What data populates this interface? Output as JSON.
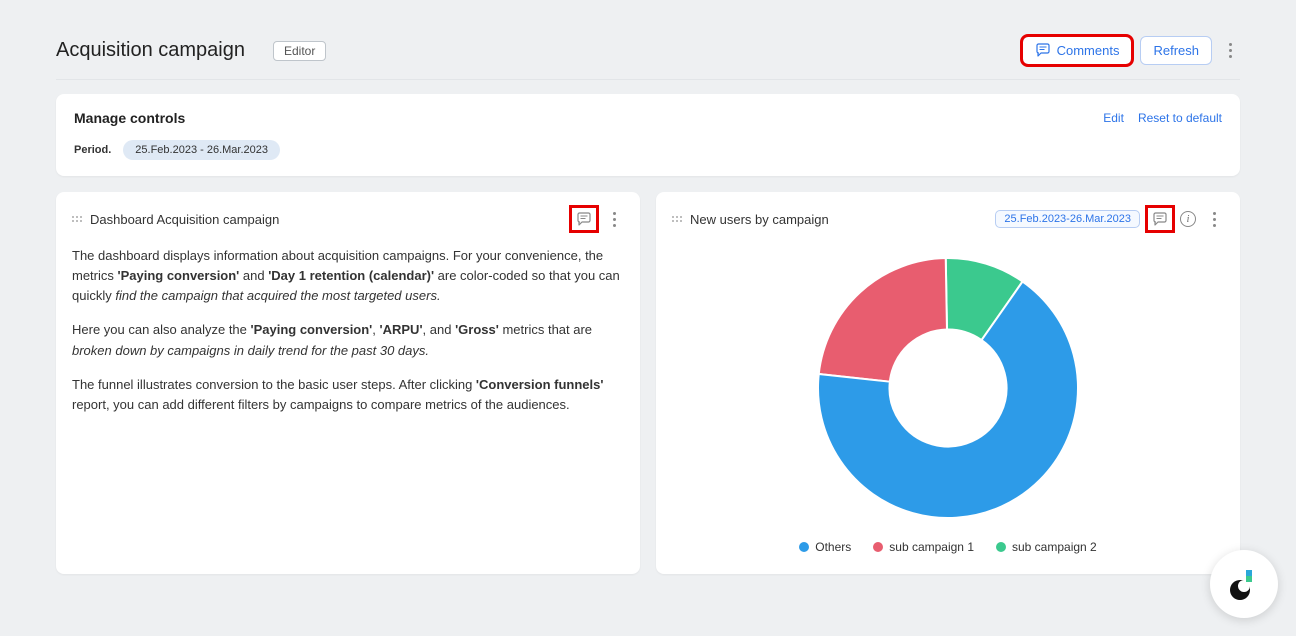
{
  "header": {
    "title": "Acquisition campaign",
    "editor_badge": "Editor",
    "comments_label": "Comments",
    "refresh_label": "Refresh"
  },
  "controls": {
    "title": "Manage controls",
    "edit_label": "Edit",
    "reset_label": "Reset to default",
    "period_label": "Period.",
    "period_value": "25.Feb.2023 - 26.Mar.2023"
  },
  "panel_left": {
    "title": "Dashboard Acquisition campaign",
    "p1_a": "The dashboard displays information about acquisition campaigns. For your convenience, the metrics ",
    "p1_b1": "'Paying conversion'",
    "p1_c": " and ",
    "p1_b2": "'Day 1 retention (calendar)'",
    "p1_d": " are color-coded so that you can quickly ",
    "p1_i": "find the campaign that acquired the most targeted users.",
    "p2_a": "Here you can also analyze the ",
    "p2_b1": "'Paying conversion'",
    "p2_c": ", ",
    "p2_b2": "'ARPU'",
    "p2_d": ", and ",
    "p2_b3": "'Gross'",
    "p2_e": " metrics that are ",
    "p2_i": "broken down by campaigns in daily trend for the past 30 days.",
    "p3_a": "The funnel illustrates conversion to the basic user steps. After clicking ",
    "p3_b": "'Conversion funnels'",
    "p3_c": " report, you can add different filters by campaigns to compare metrics of the audiences."
  },
  "panel_right": {
    "title": "New users by campaign",
    "date_chip": "25.Feb.2023-26.Mar.2023"
  },
  "colors": {
    "others": "#2d9be8",
    "sub1": "#e85d6f",
    "sub2": "#3bc98e"
  },
  "legend": {
    "others": "Others",
    "sub1": "sub campaign 1",
    "sub2": "sub campaign 2"
  },
  "chart_data": {
    "type": "pie",
    "title": "New users by campaign",
    "series": [
      {
        "name": "Others",
        "value": 67,
        "color": "#2d9be8"
      },
      {
        "name": "sub campaign 1",
        "value": 23,
        "color": "#e85d6f"
      },
      {
        "name": "sub campaign 2",
        "value": 10,
        "color": "#3bc98e"
      }
    ],
    "donut_inner_ratio": 0.45
  }
}
